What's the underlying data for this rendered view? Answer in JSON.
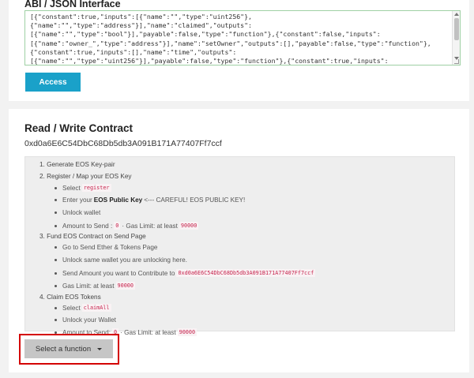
{
  "abi": {
    "title": "ABI / JSON Interface",
    "lines": [
      "[{\"constant\":true,\"inputs\":[{\"name\":\"\",\"type\":\"uint256\"},",
      "{\"name\":\"\",\"type\":\"address\"}],\"name\":\"claimed\",\"outputs\":",
      "[{\"name\":\"\",\"type\":\"bool\"}],\"payable\":false,\"type\":\"function\"},{\"constant\":false,\"inputs\":",
      "[{\"name\":\"owner_\",\"type\":\"address\"}],\"name\":\"setOwner\",\"outputs\":[],\"payable\":false,\"type\":\"function\"},",
      "{\"constant\":true,\"inputs\":[],\"name\":\"time\",\"outputs\":",
      "[{\"name\":\"\",\"type\":\"uint256\"}],\"payable\":false,\"type\":\"function\"},{\"constant\":true,\"inputs\":"
    ],
    "access_label": "Access"
  },
  "rw": {
    "title": "Read / Write Contract",
    "address": "0xd0a6E6C54DbC68Db5db3A091B171A77407Ff7ccf"
  },
  "instructions": {
    "s1": "1. Generate EOS Key-pair",
    "s2": "2. Register / Map your EOS Key",
    "s2_select": "Select",
    "s2_select_code": "register",
    "s2_enter_pre": "Enter your",
    "s2_enter_strong": "EOS Public Key",
    "s2_enter_post": "<--- CAREFUL! EOS PUBLIC KEY!",
    "s2_unlock": "Unlock wallet",
    "s2_amount_pre": "Amount to Send :",
    "s2_amount_code": "0",
    "s2_amount_mid": "· Gas Limit: at least",
    "s2_amount_gas": "90000",
    "s3": "3. Fund EOS Contract on Send Page",
    "s3_goto": "Go to Send Ether & Tokens Page",
    "s3_unlock": "Unlock same wallet you are unlocking here.",
    "s3_send_pre": "Send Amount you want to Contribute to",
    "s3_send_code": "0xd0a6E6C54DbC68Db5db3A091B171A77407Ff7ccf",
    "s3_gas_pre": "Gas Limit: at least",
    "s3_gas_code": "90000",
    "s4": "4. Claim EOS Tokens",
    "s4_select": "Select",
    "s4_select_code": "claimAll",
    "s4_unlock": "Unlock your Wallet",
    "s4_amount_pre": "Amount to Send:",
    "s4_amount_code": "0",
    "s4_amount_mid": "· Gas Limit: at least",
    "s4_amount_gas": "90000"
  },
  "function_select": {
    "label": "Select a function"
  },
  "colors": {
    "accent": "#1aa1c9",
    "highlight": "#d40000",
    "code": "#c7254e"
  }
}
